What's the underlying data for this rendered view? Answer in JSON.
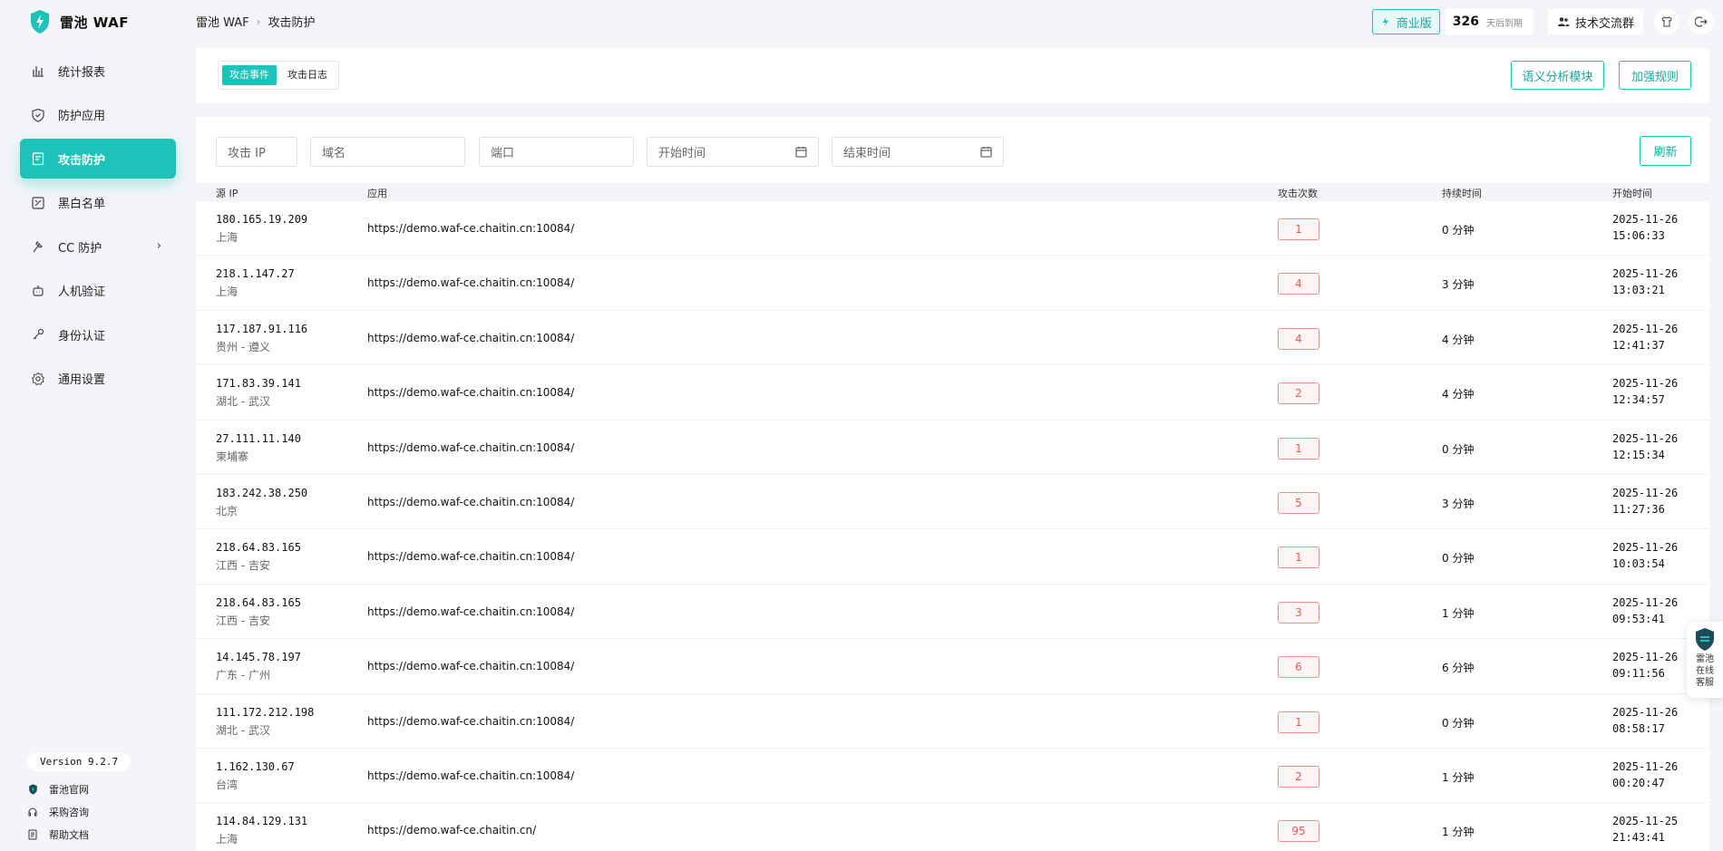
{
  "app": {
    "name": "雷池 WAF"
  },
  "sidebar": {
    "items": [
      {
        "label": "统计报表",
        "icon": "bar-chart-icon"
      },
      {
        "label": "防护应用",
        "icon": "shield-icon"
      },
      {
        "label": "攻击防护",
        "icon": "clipboard-shield-icon",
        "active": true
      },
      {
        "label": "黑白名单",
        "icon": "list-icon"
      },
      {
        "label": "CC 防护",
        "icon": "hammer-icon",
        "has_submenu": true
      },
      {
        "label": "人机验证",
        "icon": "robot-icon"
      },
      {
        "label": "身份认证",
        "icon": "key-icon"
      },
      {
        "label": "通用设置",
        "icon": "gear-icon"
      }
    ],
    "version": "Version 9.2.7",
    "footer": [
      {
        "label": "雷池官网",
        "icon": "logo-icon"
      },
      {
        "label": "采购咨询",
        "icon": "headset-icon"
      },
      {
        "label": "帮助文档",
        "icon": "document-icon"
      }
    ]
  },
  "header": {
    "breadcrumb": [
      "雷池 WAF",
      "攻击防护"
    ],
    "edition": "商业版",
    "days_num": "326",
    "days_label": "天后到期",
    "tech_group": "技术交流群"
  },
  "toolbar": {
    "tabs": [
      "攻击事件",
      "攻击日志"
    ],
    "active_tab": "攻击事件",
    "semantic_button": "语义分析模块",
    "rules_button": "加强规则"
  },
  "filters": {
    "attack_ip": "攻击 IP",
    "domain": "域名",
    "port": "端口",
    "start_time": "开始时间",
    "end_time": "结束时间",
    "refresh": "刷新"
  },
  "table": {
    "columns": [
      "源 IP",
      "应用",
      "攻击次数",
      "持续时间",
      "开始时间"
    ],
    "rows": [
      {
        "ip": "180.165.19.209",
        "loc": "上海",
        "app": "https://demo.waf-ce.chaitin.cn:10084/",
        "count": "1",
        "dur": "0 分钟",
        "date": "2025-11-26",
        "time": "15:06:33"
      },
      {
        "ip": "218.1.147.27",
        "loc": "上海",
        "app": "https://demo.waf-ce.chaitin.cn:10084/",
        "count": "4",
        "dur": "3 分钟",
        "date": "2025-11-26",
        "time": "13:03:21"
      },
      {
        "ip": "117.187.91.116",
        "loc": "贵州 - 遵义",
        "app": "https://demo.waf-ce.chaitin.cn:10084/",
        "count": "4",
        "dur": "4 分钟",
        "date": "2025-11-26",
        "time": "12:41:37"
      },
      {
        "ip": "171.83.39.141",
        "loc": "湖北 - 武汉",
        "app": "https://demo.waf-ce.chaitin.cn:10084/",
        "count": "2",
        "dur": "4 分钟",
        "date": "2025-11-26",
        "time": "12:34:57"
      },
      {
        "ip": "27.111.11.140",
        "loc": "柬埔寨",
        "app": "https://demo.waf-ce.chaitin.cn:10084/",
        "count": "1",
        "dur": "0 分钟",
        "date": "2025-11-26",
        "time": "12:15:34"
      },
      {
        "ip": "183.242.38.250",
        "loc": "北京",
        "app": "https://demo.waf-ce.chaitin.cn:10084/",
        "count": "5",
        "dur": "3 分钟",
        "date": "2025-11-26",
        "time": "11:27:36"
      },
      {
        "ip": "218.64.83.165",
        "loc": "江西 - 吉安",
        "app": "https://demo.waf-ce.chaitin.cn:10084/",
        "count": "1",
        "dur": "0 分钟",
        "date": "2025-11-26",
        "time": "10:03:54"
      },
      {
        "ip": "218.64.83.165",
        "loc": "江西 - 吉安",
        "app": "https://demo.waf-ce.chaitin.cn:10084/",
        "count": "3",
        "dur": "1 分钟",
        "date": "2025-11-26",
        "time": "09:53:41"
      },
      {
        "ip": "14.145.78.197",
        "loc": "广东 - 广州",
        "app": "https://demo.waf-ce.chaitin.cn:10084/",
        "count": "6",
        "dur": "6 分钟",
        "date": "2025-11-26",
        "time": "09:11:56"
      },
      {
        "ip": "111.172.212.198",
        "loc": "湖北 - 武汉",
        "app": "https://demo.waf-ce.chaitin.cn:10084/",
        "count": "1",
        "dur": "0 分钟",
        "date": "2025-11-26",
        "time": "08:58:17"
      },
      {
        "ip": "1.162.130.67",
        "loc": "台湾",
        "app": "https://demo.waf-ce.chaitin.cn:10084/",
        "count": "2",
        "dur": "1 分钟",
        "date": "2025-11-26",
        "time": "00:20:47"
      },
      {
        "ip": "114.84.129.131",
        "loc": "上海",
        "app": "https://demo.waf-ce.chaitin.cn/",
        "count": "95",
        "dur": "1 分钟",
        "date": "2025-11-25",
        "time": "21:43:41"
      }
    ]
  },
  "support": {
    "label": "雷池在线客服"
  },
  "colors": {
    "accent": "#1dc2b8",
    "danger": "#e85a5a",
    "background": "#f3f5f8"
  }
}
